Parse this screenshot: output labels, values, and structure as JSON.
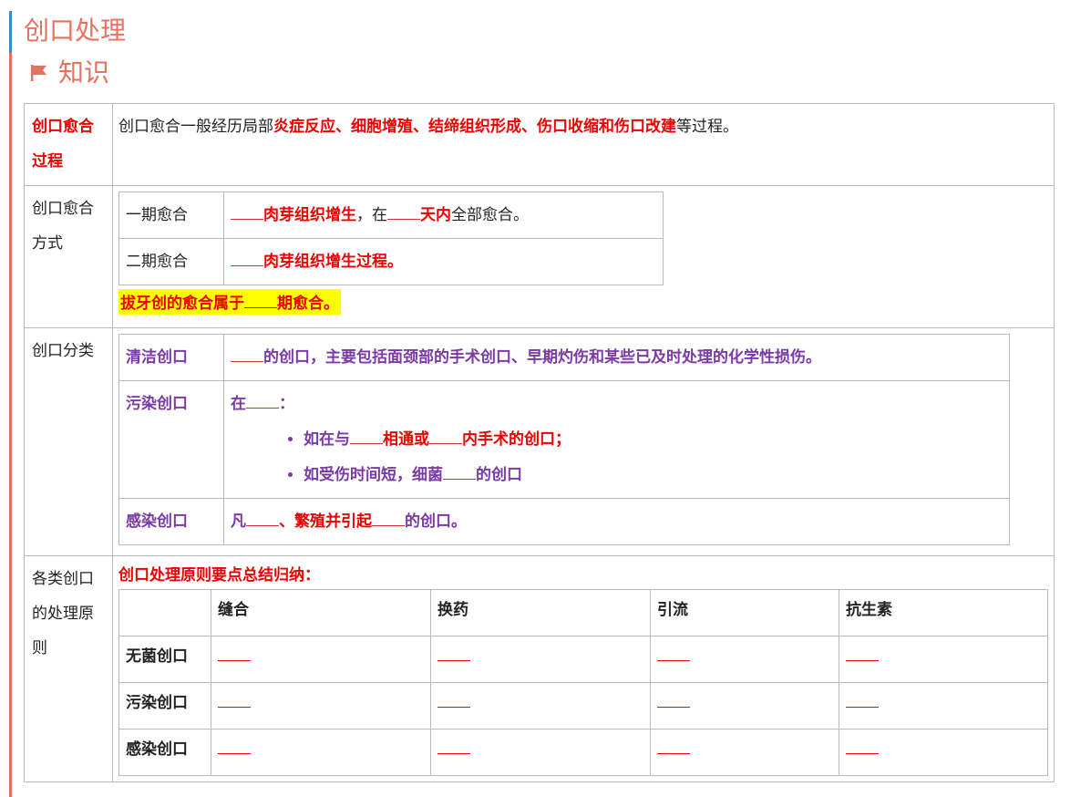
{
  "page": {
    "title": "创口处理",
    "subtitle": "知识"
  },
  "healing_process": {
    "label": "创口愈合过程",
    "text_before": "创口愈合一般经历局部",
    "text_red": "炎症反应、细胞增殖、结缔组织形成、伤口收缩和伤口改建",
    "text_after": "等过程。"
  },
  "healing_methods": {
    "label": "创口愈合方式",
    "first": {
      "label": "一期愈合",
      "part1": "肉芽组织增生",
      "part2": "，在",
      "part3": "天内",
      "part4": "全部愈合。"
    },
    "second": {
      "label": "二期愈合",
      "part1": "肉芽组织增生过程。"
    },
    "note_before": "拔牙创的愈合属于",
    "note_after": "期愈合。"
  },
  "classification": {
    "label": "创口分类",
    "clean": {
      "label": "清洁创口",
      "text": "的创口，主要包括面颈部的手术创口、早期灼伤和某些已及时处理的化学性损伤。"
    },
    "contaminated": {
      "label": "污染创口",
      "intro_before": "在",
      "intro_after": "：",
      "item1_a": "如在与",
      "item1_b": "相通或",
      "item1_c": "内手术的创口；",
      "item2_a": "如受伤时间短，细菌",
      "item2_b": "的创口"
    },
    "infected": {
      "label": "感染创口",
      "a": "凡",
      "b": "、繁殖并引起",
      "c": "的创口。"
    }
  },
  "principles": {
    "label": "各类创口的处理原则",
    "heading": "创口处理原则要点总结归纳：",
    "columns": [
      "缝合",
      "换药",
      "引流",
      "抗生素"
    ],
    "rows": [
      "无菌创口",
      "污染创口",
      "感染创口"
    ]
  },
  "colors": {
    "accent": "#e3735e",
    "red": "#e00000",
    "purple": "#7b3aa5",
    "highlight": "#ffff00"
  }
}
